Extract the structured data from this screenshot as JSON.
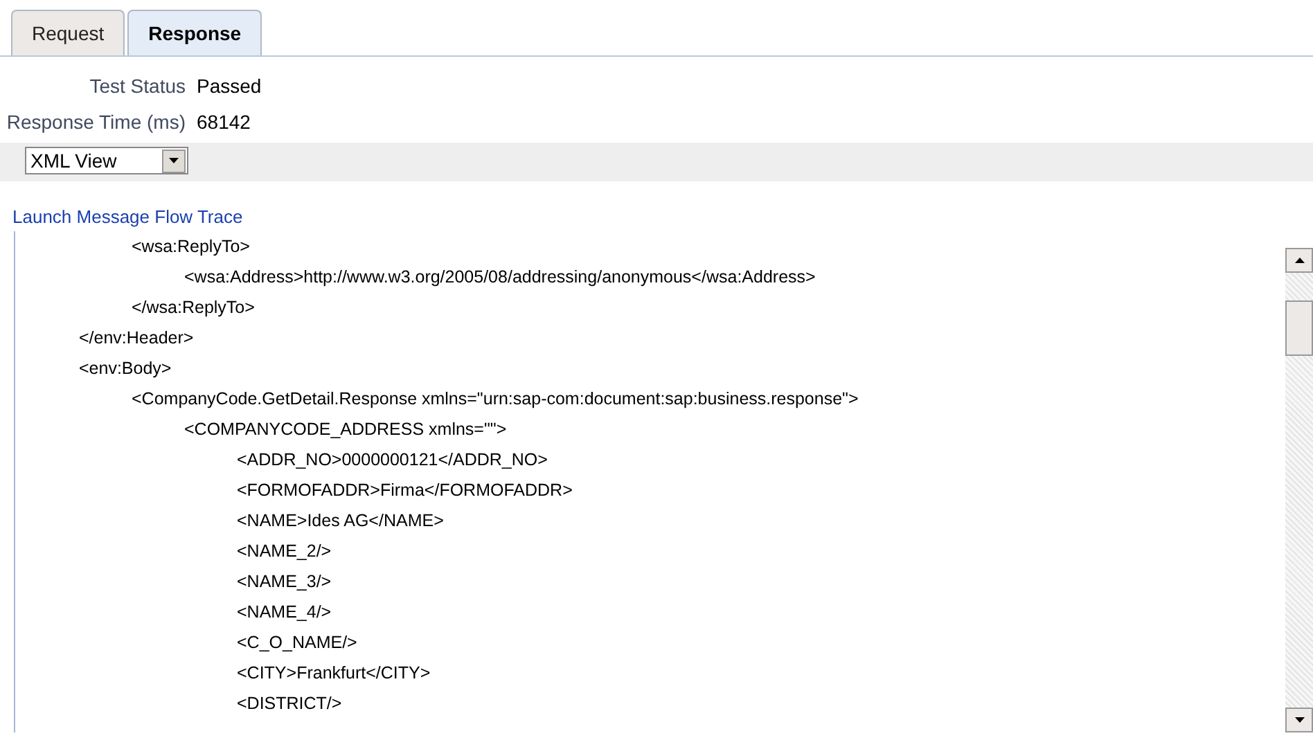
{
  "tabs": [
    {
      "label": "Request",
      "selected": false
    },
    {
      "label": "Response",
      "selected": true
    }
  ],
  "summary": [
    {
      "label": "Test Status",
      "value": "Passed"
    },
    {
      "label": "Response Time (ms)",
      "value": "68142"
    }
  ],
  "view_select": {
    "value": "XML View"
  },
  "trace_link": "Launch Message Flow Trace",
  "xml_lines": [
    {
      "children": [
        {
          "text": "<wsa:ReplyTo>",
          "children": [
            {
              "text": "<wsa:Address>http://www.w3.org/2005/08/addressing/anonymous</wsa:Address>"
            }
          ]
        },
        {
          "text": "</wsa:ReplyTo>"
        }
      ]
    },
    {
      "text": "</env:Header>"
    },
    {
      "text": "<env:Body>",
      "children": [
        {
          "text": "<CompanyCode.GetDetail.Response xmlns=\"urn:sap-com:document:sap:business.response\">",
          "children": [
            {
              "text": "<COMPANYCODE_ADDRESS xmlns=\"\">",
              "children": [
                {
                  "text": "<ADDR_NO>0000000121</ADDR_NO>"
                },
                {
                  "text": "<FORMOFADDR>Firma</FORMOFADDR>"
                },
                {
                  "text": "<NAME>Ides AG</NAME>"
                },
                {
                  "text": "<NAME_2/>"
                },
                {
                  "text": "<NAME_3/>"
                },
                {
                  "text": "<NAME_4/>"
                },
                {
                  "text": "<C_O_NAME/>"
                },
                {
                  "text": "<CITY>Frankfurt</CITY>"
                },
                {
                  "text": "<DISTRICT/>"
                }
              ]
            }
          ]
        }
      ]
    }
  ]
}
